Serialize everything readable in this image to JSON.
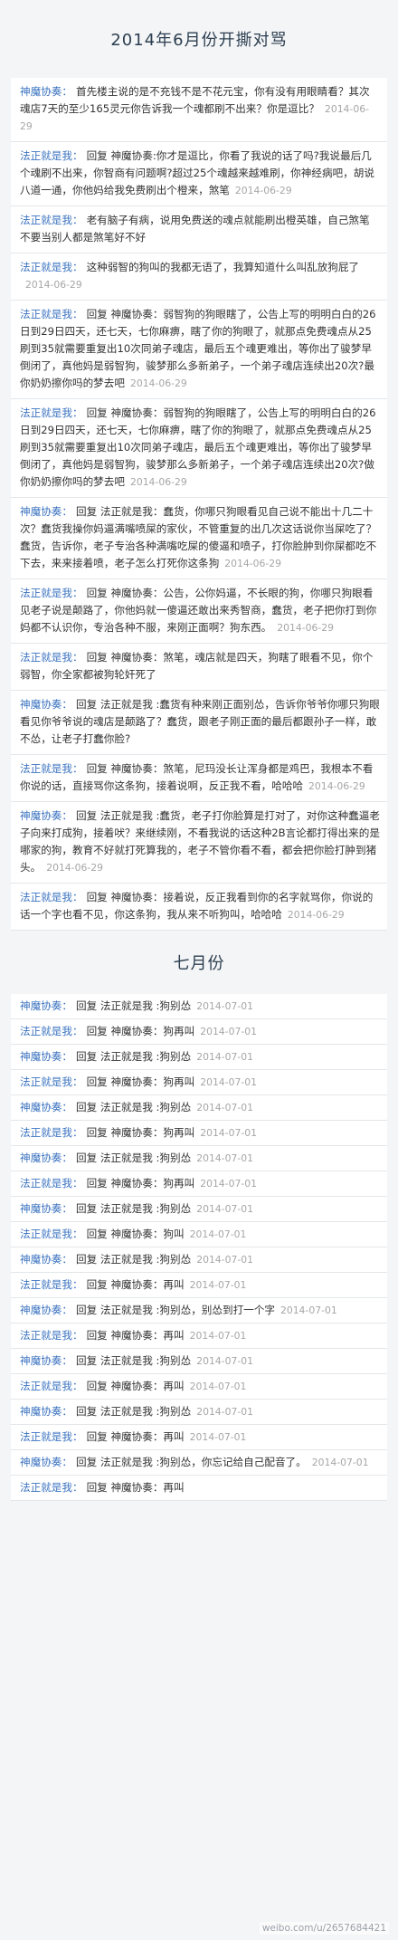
{
  "june": {
    "title": "2014年6月份开撕对骂",
    "rows": [
      {
        "author": "神魔协奏：",
        "text": "首先楼主说的是不充钱不是不花元宝，你有没有用眼睛看？其次魂店7天的至少165灵元你告诉我一个魂都刷不出来？你是逗比？",
        "time": "2014-06-29"
      },
      {
        "author": "法正就是我：",
        "text": "回复 神魔协奏:你才是逗比，你看了我说的话了吗?我说最后几个魂刷不出来，你智商有问题啊?超过25个魂越来越难刷，你神经病吧，胡说八道一通，你他妈给我免费刷出个橙来，煞笔",
        "time": "2014-06-29"
      },
      {
        "author": "法正就是我：",
        "text": "老有脑子有病，说用免费送的魂点就能刷出橙英雄，自己煞笔不要当别人都是煞笔好不好",
        "time": ""
      },
      {
        "author": "法正就是我：",
        "text": "这种弱智的狗叫的我都无语了，我算知道什么叫乱放狗屁了",
        "time": "2014-06-29"
      },
      {
        "author": "法正就是我：",
        "text": "回复 神魔协奏：弱智狗的狗眼瞎了，公告上写的明明白白的26日到29日四天，还七天，七你麻痹，瞎了你的狗眼了，就那点免费魂点从25刷到35就需要重复出10次同弟子魂店，最后五个魂更难出，等你出了骏梦早倒闭了，真他妈是弱智狗，骏梦那么多新弟子，一个弟子魂店连续出20次?最你奶奶擦你吗的梦去吧",
        "time": "2014-06-29"
      },
      {
        "author": "法正就是我：",
        "text": "回复 神魔协奏：弱智狗的狗眼瞎了，公告上写的明明白白的26日到29日四天，还七天，七你麻痹，瞎了你的狗眼了，就那点免费魂点从25刷到35就需要重复出10次同弟子魂店，最后五个魂更难出，等你出了骏梦早倒闭了，真他妈是弱智狗，骏梦那么多新弟子，一个弟子魂店连续出20次?做你奶奶擦你吗的梦去吧",
        "time": "2014-06-29"
      },
      {
        "author": "神魔协奏：",
        "text": "回复 法正就是我：蠢货，你哪只狗眼看见自己说不能出十几二十次？蠢货我操你妈逼满嘴喷屎的家伙，不管重复的出几次这话说你当屎吃了？蠢货，告诉你，老子专治各种满嘴吃屎的傻逼和喷子，打你脸肿到你屎都吃不下去，来来接着喷，老子怎么打死你这条狗",
        "time": "2014-06-29"
      },
      {
        "author": "法正就是我：",
        "text": "回复 神魔协奏：公告，公你妈逼，不长眼的狗，你哪只狗眼看见老子说是颠路了，你他妈就一傻逼还敢出来秀智商，蠢货，老子把你打到你妈都不认识你，专治各种不服，来刚正面啊？狗东西。",
        "time": "2014-06-29"
      },
      {
        "author": "法正就是我：",
        "text": "回复 神魔协奏：煞笔，魂店就是四天，狗瞎了眼看不见，你个弱智，你全家都被狗轮奸死了",
        "time": ""
      },
      {
        "author": "神魔协奏：",
        "text": "回复 法正就是我 :蠢货有种来刚正面别怂，告诉你爷爷你哪只狗眼看见你爷爷说的魂店是颠路了？蠢货，跟老子刚正面的最后都跟孙子一样，敢不怂，让老子打蠢你脸?",
        "time": ""
      },
      {
        "author": "法正就是我：",
        "text": "回复 神魔协奏：煞笔，尼玛没长让浑身都是鸡巴，我根本不看你说的话，直接骂你这条狗，接着说啊，反正我不看，哈哈哈",
        "time": "2014-06-29"
      },
      {
        "author": "神魔协奏：",
        "text": "回复 法正就是我 :蠢货，老子打你脸算是打对了，对你这种蠢逼老子向来打成狗，接着吠？来继续刚，不看我说的话这种2B言论都打得出来的是哪家的狗，教育不好就打死算我的，老子不管你看不看，都会把你脸打肿到猪头。",
        "time": "2014-06-29"
      },
      {
        "author": "法正就是我：",
        "text": "回复 神魔协奏：接着说，反正我看到你的名字就骂你，你说的话一个字也看不见，你这条狗，我从来不听狗叫，哈哈哈",
        "time": "2014-06-29"
      }
    ]
  },
  "july": {
    "title": "七月份",
    "rows": [
      {
        "author": "神魔协奏：",
        "text": "回复 法正就是我 :狗别怂",
        "time": "2014-07-01"
      },
      {
        "author": "法正就是我：",
        "text": "回复 神魔协奏：狗再叫",
        "time": "2014-07-01"
      },
      {
        "author": "神魔协奏：",
        "text": "回复 法正就是我 :狗别怂",
        "time": "2014-07-01"
      },
      {
        "author": "法正就是我：",
        "text": "回复 神魔协奏：狗再叫",
        "time": "2014-07-01"
      },
      {
        "author": "神魔协奏：",
        "text": "回复 法正就是我 :狗别怂",
        "time": "2014-07-01"
      },
      {
        "author": "法正就是我：",
        "text": "回复 神魔协奏：狗再叫",
        "time": "2014-07-01"
      },
      {
        "author": "神魔协奏：",
        "text": "回复 法正就是我 :狗别怂",
        "time": "2014-07-01"
      },
      {
        "author": "法正就是我：",
        "text": "回复 神魔协奏：狗再叫",
        "time": "2014-07-01"
      },
      {
        "author": "神魔协奏：",
        "text": "回复 法正就是我 :狗别怂",
        "time": "2014-07-01"
      },
      {
        "author": "法正就是我：",
        "text": "回复 神魔协奏：狗叫",
        "time": "2014-07-01"
      },
      {
        "author": "神魔协奏：",
        "text": "回复 法正就是我 :狗别怂",
        "time": "2014-07-01"
      },
      {
        "author": "法正就是我：",
        "text": "回复 神魔协奏：再叫",
        "time": "2014-07-01"
      },
      {
        "author": "神魔协奏：",
        "text": "回复 法正就是我 :狗别怂，别怂到打一个字",
        "time": "2014-07-01"
      },
      {
        "author": "法正就是我：",
        "text": "回复 神魔协奏：再叫",
        "time": "2014-07-01"
      },
      {
        "author": "神魔协奏：",
        "text": "回复 法正就是我 :狗别怂",
        "time": "2014-07-01"
      },
      {
        "author": "法正就是我：",
        "text": "回复 神魔协奏：再叫",
        "time": "2014-07-01"
      },
      {
        "author": "神魔协奏：",
        "text": "回复 法正就是我 :狗别怂",
        "time": "2014-07-01"
      },
      {
        "author": "法正就是我：",
        "text": "回复 神魔协奏：再叫",
        "time": "2014-07-01"
      },
      {
        "author": "神魔协奏：",
        "text": "回复 法正就是我 :狗别怂，你忘记给自己配音了。",
        "time": "2014-07-01"
      },
      {
        "author": "法正就是我：",
        "text": "回复 神魔协奏：再叫",
        "time": ""
      }
    ]
  },
  "watermark": "weibo.com/u/2657684421"
}
